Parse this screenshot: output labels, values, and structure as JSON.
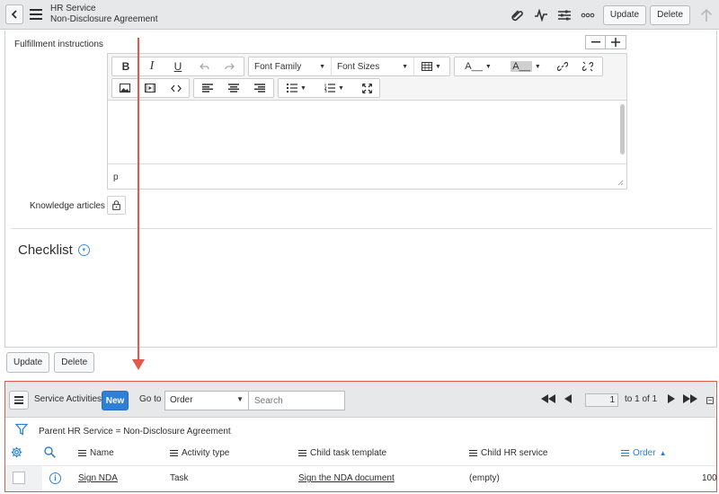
{
  "header": {
    "title": "HR Service",
    "subtitle": "Non-Disclosure Agreement",
    "update_label": "Update",
    "delete_label": "Delete"
  },
  "form": {
    "fulfillment_label": "Fulfillment instructions",
    "editor": {
      "font_family": "Font Family",
      "font_sizes": "Font Sizes",
      "status_path": "p"
    },
    "knowledge_label": "Knowledge articles",
    "checklist_title": "Checklist"
  },
  "bottom_buttons": {
    "update_label": "Update",
    "delete_label": "Delete"
  },
  "related_list": {
    "title": "Service Activities",
    "new_label": "New",
    "goto_label": "Go to",
    "goto_value": "Order",
    "search_placeholder": "Search",
    "page_value": "1",
    "page_total": "to 1 of 1",
    "filter_text": "Parent HR Service = Non-Disclosure Agreement",
    "columns": [
      "Name",
      "Activity type",
      "Child task template",
      "Child HR service",
      "Order"
    ],
    "rows": [
      {
        "name": "Sign NDA",
        "activity_type": "Task",
        "child_task_template": "Sign the NDA document",
        "child_hr_service": "(empty)",
        "order": "100"
      }
    ]
  },
  "colors": {
    "accent": "#2e7fd6",
    "highlight": "#e2584b"
  }
}
